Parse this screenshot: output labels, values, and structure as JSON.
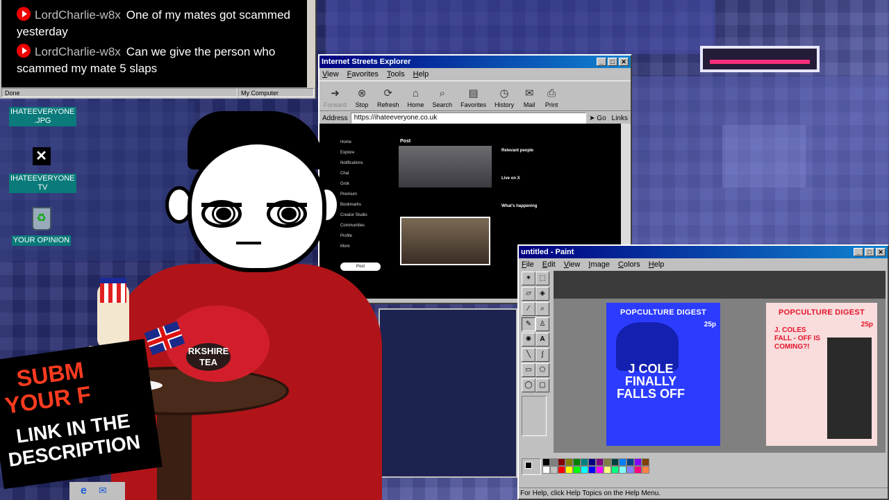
{
  "chat": {
    "messages": [
      {
        "author": "LordCharlie-w8x",
        "text": "One of my mates got scammed yesterday"
      },
      {
        "author": "LordCharlie-w8x",
        "text": "Can we give the person who scammed my mate 5 slaps"
      }
    ],
    "status_left": "Done",
    "status_right": "My Computer"
  },
  "desktop": {
    "icons": [
      {
        "label": "IHATEEVERYONE .JPG",
        "icon": "image-file-icon"
      },
      {
        "label": "",
        "icon": "x-logo-icon"
      },
      {
        "label": "IHATEEVERYONE TV",
        "icon": "tv-icon"
      },
      {
        "label": "YOUR OPINION",
        "icon": "recycle-bin-icon"
      }
    ]
  },
  "browser": {
    "title": "Internet Streets Explorer",
    "menu": [
      "View",
      "Favorites",
      "Tools",
      "Help"
    ],
    "toolbar": [
      "Forward",
      "Stop",
      "Refresh",
      "Home",
      "Search",
      "Favorites",
      "History",
      "Mail",
      "Print"
    ],
    "address_label": "Address",
    "url": "https://ihateeveryone.co.uk",
    "go_label": "Go",
    "links_label": "Links",
    "x_nav": [
      "Home",
      "Explore",
      "Notifications",
      "Chat",
      "Grok",
      "Premium",
      "Bookmarks",
      "Creator Studio",
      "Communities",
      "Profile",
      "More"
    ],
    "x_post_button": "Post",
    "x_header": "Post",
    "x_side_relevant": "Relevant people",
    "x_side_live": "Live on X",
    "x_side_happening": "What's happening"
  },
  "paint": {
    "title": "untitled - Paint",
    "menu": [
      "File",
      "Edit",
      "View",
      "Image",
      "Colors",
      "Help"
    ],
    "status": "For Help, click Help Topics on the Help Menu.",
    "palette": [
      "#000000",
      "#808080",
      "#800000",
      "#808000",
      "#008000",
      "#008080",
      "#000080",
      "#800080",
      "#808040",
      "#004040",
      "#0080ff",
      "#004080",
      "#8000ff",
      "#804000",
      "#ffffff",
      "#c0c0c0",
      "#ff0000",
      "#ffff00",
      "#00ff00",
      "#00ffff",
      "#0000ff",
      "#ff00ff",
      "#ffff80",
      "#00ff80",
      "#80ffff",
      "#8080ff",
      "#ff0080",
      "#ff8040"
    ],
    "mag1": {
      "title": "POPCULTURE DIGEST",
      "headline": "J COLE FINALLY FALLS OFF",
      "price": "25p"
    },
    "mag2": {
      "title": "POPCULTURE DIGEST",
      "headline": "J. COLES FALL - OFF IS COMING?!",
      "price": "25p"
    }
  },
  "banner": {
    "line1": "SUBM",
    "line2": "YOUR F",
    "line3": "LINK IN THE",
    "line4": "DESCRIPTION"
  },
  "teapot": {
    "label": "RKSHIRE TEA"
  }
}
